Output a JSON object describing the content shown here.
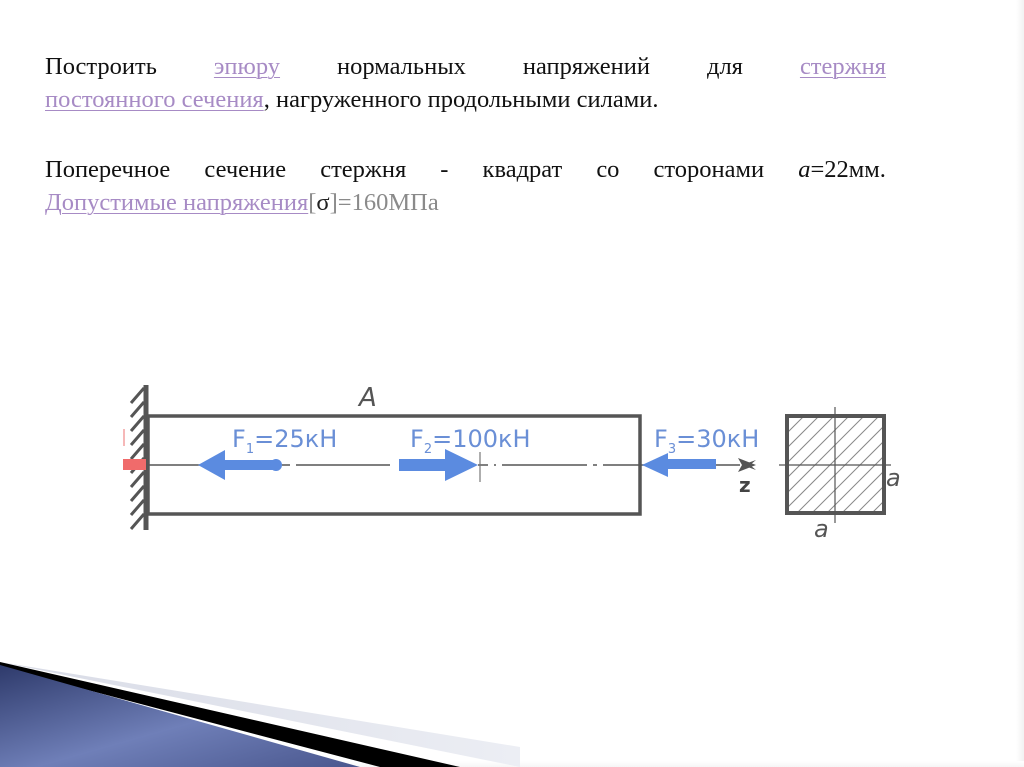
{
  "slide": {
    "paragraph1": {
      "line1": {
        "word1": "Построить",
        "link1": "эпюру",
        "word2": "нормальных",
        "word3": "напряжений",
        "word4": "для",
        "link2": "стержня"
      },
      "line2": {
        "link3": "постоянного сечения",
        "rest": ", нагруженного продольными силами."
      }
    },
    "paragraph2": {
      "line1": {
        "words": [
          "Поперечное",
          "сечение",
          "стержня",
          "-",
          "квадрат",
          "со",
          "сторонами"
        ],
        "var": "a",
        "value": "=22мм."
      },
      "line2": {
        "link": "Допустимые напряжения",
        "bracket_open": " [",
        "sigma": "σ",
        "bracket_rest": "]=160МПа"
      }
    }
  },
  "diagram": {
    "section_label": "A",
    "axis_label": "z",
    "forces": [
      {
        "name": "F",
        "sub": "1",
        "value": "=25кН",
        "direction": "left"
      },
      {
        "name": "F",
        "sub": "2",
        "value": "=100кН",
        "direction": "right"
      },
      {
        "name": "F",
        "sub": "3",
        "value": "=30кН",
        "direction": "left"
      }
    ],
    "cross_section": {
      "shape": "square",
      "side_label_right": "a",
      "side_label_bottom": "a"
    },
    "colors": {
      "force_arrow": "#5b8be0",
      "force_label": "#6a8fd6",
      "beam": "#555555",
      "support_marker": "#f06b6b"
    }
  }
}
